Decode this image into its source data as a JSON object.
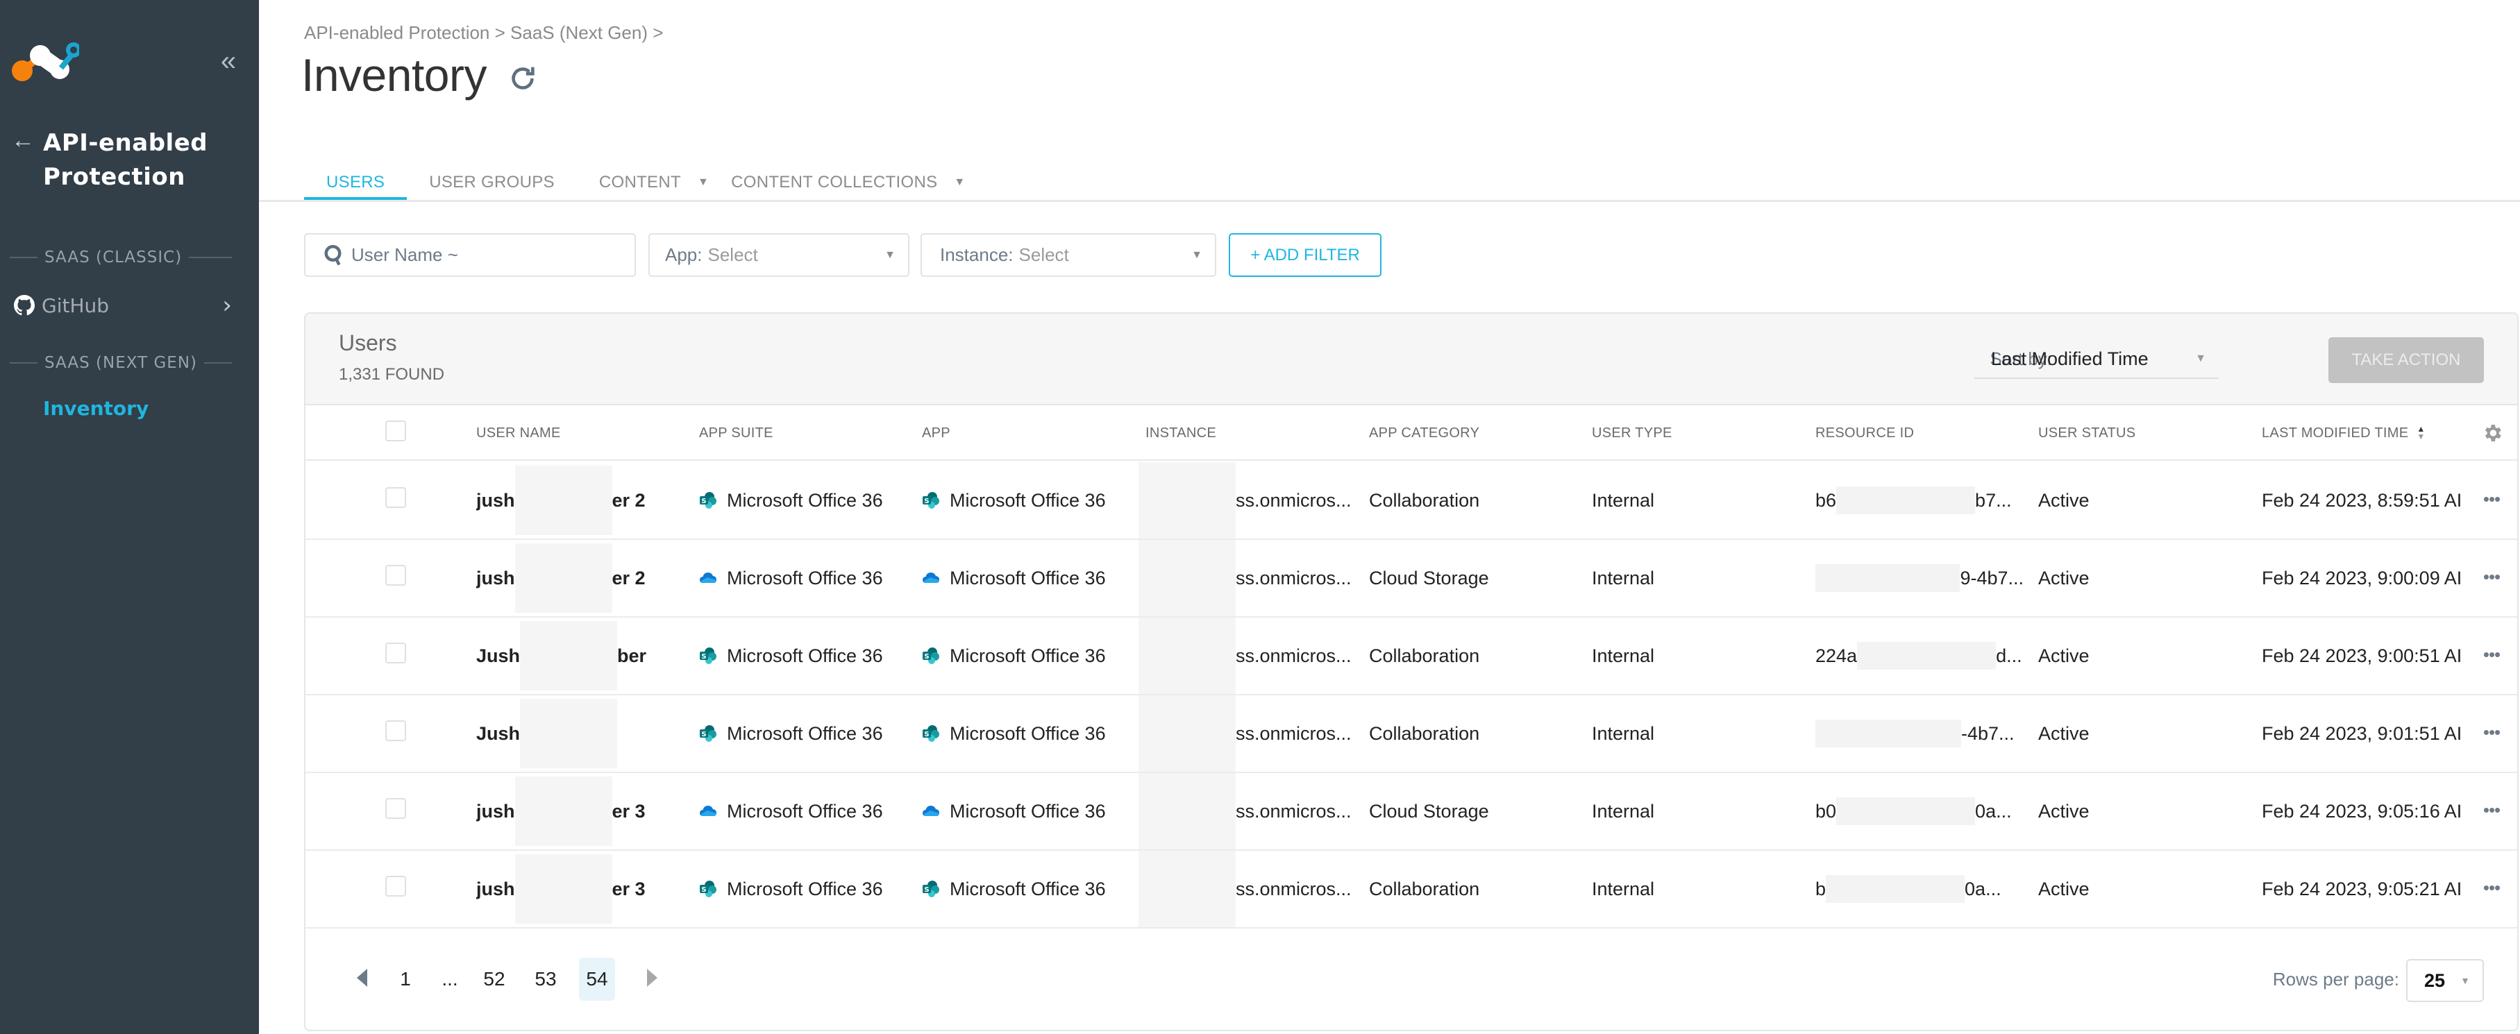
{
  "sidebar": {
    "collapse_icon": "double-chevron-left-icon",
    "back_icon": "arrow-left-icon",
    "section_title": "API-enabled Protection",
    "groups": [
      {
        "label": "SAAS (CLASSIC)",
        "items": [
          {
            "label": "GitHub",
            "icon": "github-icon",
            "has_submenu": true
          }
        ]
      },
      {
        "label": "SAAS (NEXT GEN)",
        "items": [
          {
            "label": "Inventory",
            "active": true
          }
        ]
      }
    ]
  },
  "header": {
    "breadcrumb": "API-enabled Protection > SaaS (Next Gen) >",
    "title": "Inventory",
    "refresh_icon": "refresh-icon"
  },
  "tabs": [
    {
      "label": "USERS",
      "active": true,
      "dropdown": false
    },
    {
      "label": "USER GROUPS",
      "active": false,
      "dropdown": false
    },
    {
      "label": "CONTENT",
      "active": false,
      "dropdown": true
    },
    {
      "label": "CONTENT COLLECTIONS",
      "active": false,
      "dropdown": true
    }
  ],
  "filters": {
    "search": {
      "placeholder": "User Name ~",
      "value": ""
    },
    "app": {
      "label": "App:",
      "value": "Select"
    },
    "instance": {
      "label": "Instance:",
      "value": "Select"
    },
    "add_filter_label": "+ ADD FILTER"
  },
  "table": {
    "title": "Users",
    "count": "1,331 FOUND",
    "sort_by_label": "Sort by:",
    "sort_by_value": "Last Modified Time",
    "take_action_label": "TAKE ACTION",
    "columns": [
      "USER NAME",
      "APP SUITE",
      "APP",
      "INSTANCE",
      "APP CATEGORY",
      "USER TYPE",
      "RESOURCE ID",
      "USER STATUS",
      "LAST MODIFIED TIME"
    ],
    "sorted_column": "LAST MODIFIED TIME",
    "rows": [
      {
        "user_name_start": "jush",
        "user_name_end": "er 2",
        "app_icon": "sharepoint-icon",
        "app_suite": "Microsoft Office 36",
        "app": "Microsoft Office 36",
        "instance": "ss.onmicros...",
        "app_category": "Collaboration",
        "user_type": "Internal",
        "resource_id_start": "b6",
        "resource_id_end": "b7...",
        "user_status": "Active",
        "last_modified": "Feb 24 2023, 8:59:51 AI"
      },
      {
        "user_name_start": "jush",
        "user_name_end": "er 2",
        "app_icon": "onedrive-icon",
        "app_suite": "Microsoft Office 36",
        "app": "Microsoft Office 36",
        "instance": "ss.onmicros...",
        "app_category": "Cloud Storage",
        "user_type": "Internal",
        "resource_id_start": "",
        "resource_id_end": "9-4b7...",
        "user_status": "Active",
        "last_modified": "Feb 24 2023, 9:00:09 AI"
      },
      {
        "user_name_start": "Jush",
        "user_name_end": "ber",
        "app_icon": "sharepoint-icon",
        "app_suite": "Microsoft Office 36",
        "app": "Microsoft Office 36",
        "instance": "ss.onmicros...",
        "app_category": "Collaboration",
        "user_type": "Internal",
        "resource_id_start": "224a",
        "resource_id_end": "d...",
        "user_status": "Active",
        "last_modified": "Feb 24 2023, 9:00:51 AI"
      },
      {
        "user_name_start": "Jush",
        "user_name_end": "",
        "app_icon": "sharepoint-icon",
        "app_suite": "Microsoft Office 36",
        "app": "Microsoft Office 36",
        "instance": "ss.onmicros...",
        "app_category": "Collaboration",
        "user_type": "Internal",
        "resource_id_start": "",
        "resource_id_end": "-4b7...",
        "user_status": "Active",
        "last_modified": "Feb 24 2023, 9:01:51 AI"
      },
      {
        "user_name_start": "jush",
        "user_name_end": "er 3",
        "app_icon": "onedrive-icon",
        "app_suite": "Microsoft Office 36",
        "app": "Microsoft Office 36",
        "instance": "ss.onmicros...",
        "app_category": "Cloud Storage",
        "user_type": "Internal",
        "resource_id_start": "b0",
        "resource_id_end": "0a...",
        "user_status": "Active",
        "last_modified": "Feb 24 2023, 9:05:16 AI"
      },
      {
        "user_name_start": "jush",
        "user_name_end": "er 3",
        "app_icon": "sharepoint-icon",
        "app_suite": "Microsoft Office 36",
        "app": "Microsoft Office 36",
        "instance": "ss.onmicros...",
        "app_category": "Collaboration",
        "user_type": "Internal",
        "resource_id_start": "b",
        "resource_id_end": "0a...",
        "user_status": "Active",
        "last_modified": "Feb 24 2023, 9:05:21 AI"
      }
    ]
  },
  "pagination": {
    "pages": [
      "1",
      "...",
      "52",
      "53",
      "54"
    ],
    "current_page": "54",
    "rows_per_page_label": "Rows per page:",
    "rows_per_page_value": "25"
  },
  "colors": {
    "accent": "#1fb6e0",
    "sidebar_bg": "#323e48",
    "logo_orange": "#f5820d",
    "logo_blue": "#1aa5d0"
  }
}
